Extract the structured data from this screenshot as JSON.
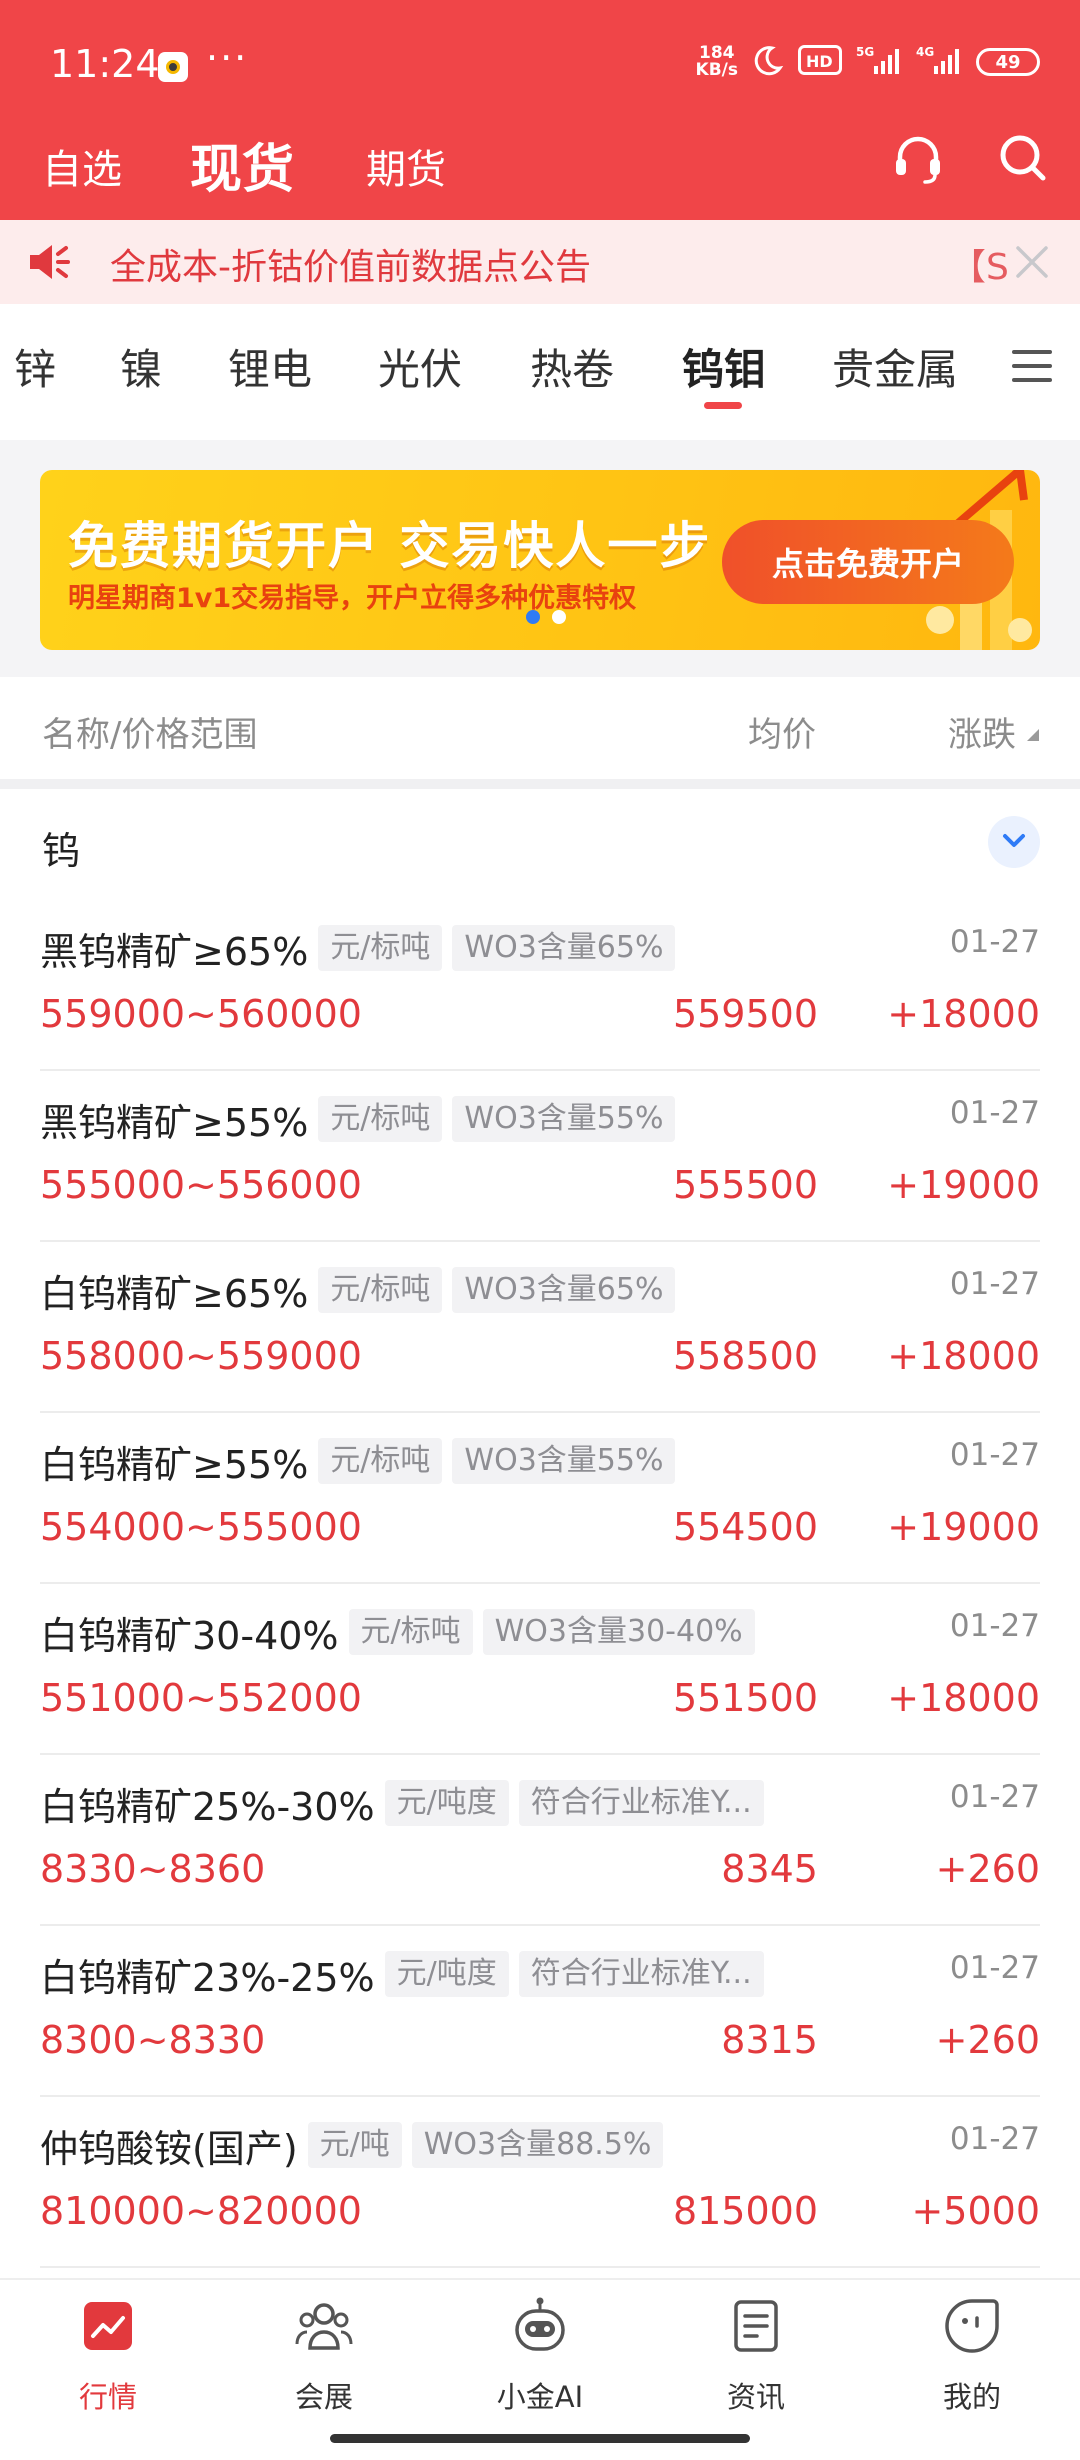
{
  "status_bar": {
    "time": "11:24",
    "dots": "···",
    "net_speed_value": "184",
    "net_speed_unit": "KB/s",
    "battery": "49"
  },
  "top_nav": {
    "tabs": [
      {
        "label": "自选"
      },
      {
        "label": "现货"
      },
      {
        "label": "期货"
      }
    ],
    "active_tab": "现货"
  },
  "notice": {
    "text": "全成本-折钴价值前数据点公告",
    "tail": "【S"
  },
  "categories": {
    "items": [
      {
        "label": "锌"
      },
      {
        "label": "镍"
      },
      {
        "label": "锂电"
      },
      {
        "label": "光伏"
      },
      {
        "label": "热卷"
      },
      {
        "label": "钨钼"
      },
      {
        "label": "贵金属"
      }
    ],
    "active": "钨钼"
  },
  "banner": {
    "title": "免费期货开户  交易快人一步",
    "subtitle": "明星期商1v1交易指导，开户立得多种优惠特权",
    "button": "点击免费开户",
    "slide_index": 1,
    "slide_count": 2
  },
  "table_header": {
    "name": "名称/价格范围",
    "avg": "均价",
    "change": "涨跌"
  },
  "group": {
    "title": "钨"
  },
  "rows": [
    {
      "name": "黑钨精矿≥65%",
      "unit": "元/标吨",
      "spec": "WO3含量65%",
      "date": "01-27",
      "range": "559000~560000",
      "avg": "559500",
      "change": "+18000"
    },
    {
      "name": "黑钨精矿≥55%",
      "unit": "元/标吨",
      "spec": "WO3含量55%",
      "date": "01-27",
      "range": "555000~556000",
      "avg": "555500",
      "change": "+19000"
    },
    {
      "name": "白钨精矿≥65%",
      "unit": "元/标吨",
      "spec": "WO3含量65%",
      "date": "01-27",
      "range": "558000~559000",
      "avg": "558500",
      "change": "+18000"
    },
    {
      "name": "白钨精矿≥55%",
      "unit": "元/标吨",
      "spec": "WO3含量55%",
      "date": "01-27",
      "range": "554000~555000",
      "avg": "554500",
      "change": "+19000"
    },
    {
      "name": "白钨精矿30-40%",
      "unit": "元/标吨",
      "spec": "WO3含量30-40%",
      "date": "01-27",
      "range": "551000~552000",
      "avg": "551500",
      "change": "+18000"
    },
    {
      "name": "白钨精矿25%-30%",
      "unit": "元/吨度",
      "spec": "符合行业标准Y...",
      "date": "01-27",
      "range": "8330~8360",
      "avg": "8345",
      "change": "+260"
    },
    {
      "name": "白钨精矿23%-25%",
      "unit": "元/吨度",
      "spec": "符合行业标准Y...",
      "date": "01-27",
      "range": "8300~8330",
      "avg": "8315",
      "change": "+260"
    },
    {
      "name": "仲钨酸铵(国产)",
      "unit": "元/吨",
      "spec": "WO3含量88.5%",
      "date": "01-27",
      "range": "810000~820000",
      "avg": "815000",
      "change": "+5000"
    }
  ],
  "bottom_nav": {
    "items": [
      {
        "label": "行情",
        "icon": "chart-trend-icon"
      },
      {
        "label": "会展",
        "icon": "people-icon"
      },
      {
        "label": "小金AI",
        "icon": "robot-icon"
      },
      {
        "label": "资讯",
        "icon": "document-icon"
      },
      {
        "label": "我的",
        "icon": "profile-face-icon"
      }
    ],
    "active": "行情"
  },
  "colors": {
    "brand_red": "#f04548",
    "price_red": "#e2393d",
    "banner_yellow": "#ffc414",
    "accent_blue": "#2f7bf6"
  }
}
